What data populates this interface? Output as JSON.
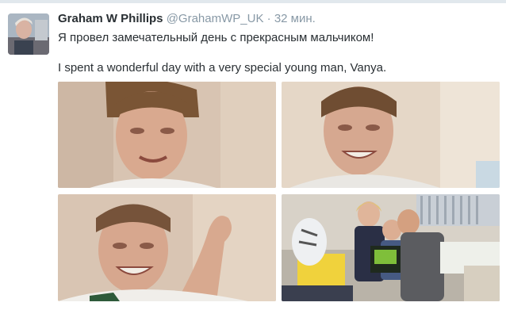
{
  "tweet": {
    "author_name": "Graham W Phillips",
    "author_handle": "@GrahamWP_UK",
    "separator": "·",
    "time": "32 мин.",
    "text_ru": "Я провел замечательный день с прекрасным мальчиком!",
    "text_en": "I spent a wonderful day with a very special young man, Vanya."
  },
  "colors": {
    "name": "#292f33",
    "meta": "#8899a6",
    "border": "#e1e8ed"
  },
  "photos": [
    "boy-portrait",
    "boy-smiling",
    "boy-flexing-arm",
    "family-hospital-room"
  ]
}
